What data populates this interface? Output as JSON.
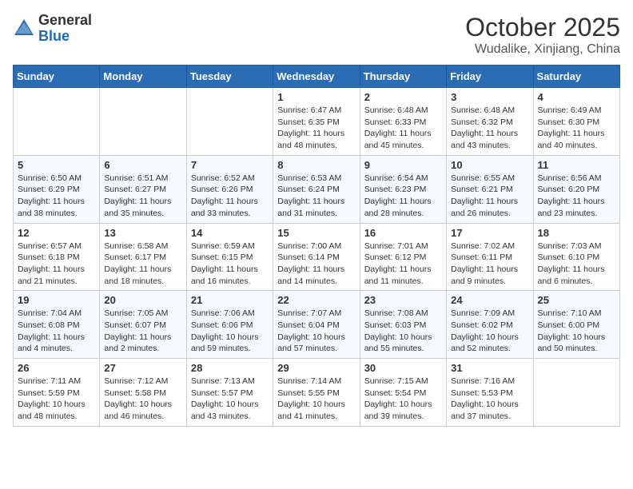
{
  "header": {
    "logo_general": "General",
    "logo_blue": "Blue",
    "month": "October 2025",
    "location": "Wudalike, Xinjiang, China"
  },
  "weekdays": [
    "Sunday",
    "Monday",
    "Tuesday",
    "Wednesday",
    "Thursday",
    "Friday",
    "Saturday"
  ],
  "weeks": [
    [
      {
        "day": "",
        "info": ""
      },
      {
        "day": "",
        "info": ""
      },
      {
        "day": "",
        "info": ""
      },
      {
        "day": "1",
        "info": "Sunrise: 6:47 AM\nSunset: 6:35 PM\nDaylight: 11 hours\nand 48 minutes."
      },
      {
        "day": "2",
        "info": "Sunrise: 6:48 AM\nSunset: 6:33 PM\nDaylight: 11 hours\nand 45 minutes."
      },
      {
        "day": "3",
        "info": "Sunrise: 6:48 AM\nSunset: 6:32 PM\nDaylight: 11 hours\nand 43 minutes."
      },
      {
        "day": "4",
        "info": "Sunrise: 6:49 AM\nSunset: 6:30 PM\nDaylight: 11 hours\nand 40 minutes."
      }
    ],
    [
      {
        "day": "5",
        "info": "Sunrise: 6:50 AM\nSunset: 6:29 PM\nDaylight: 11 hours\nand 38 minutes."
      },
      {
        "day": "6",
        "info": "Sunrise: 6:51 AM\nSunset: 6:27 PM\nDaylight: 11 hours\nand 35 minutes."
      },
      {
        "day": "7",
        "info": "Sunrise: 6:52 AM\nSunset: 6:26 PM\nDaylight: 11 hours\nand 33 minutes."
      },
      {
        "day": "8",
        "info": "Sunrise: 6:53 AM\nSunset: 6:24 PM\nDaylight: 11 hours\nand 31 minutes."
      },
      {
        "day": "9",
        "info": "Sunrise: 6:54 AM\nSunset: 6:23 PM\nDaylight: 11 hours\nand 28 minutes."
      },
      {
        "day": "10",
        "info": "Sunrise: 6:55 AM\nSunset: 6:21 PM\nDaylight: 11 hours\nand 26 minutes."
      },
      {
        "day": "11",
        "info": "Sunrise: 6:56 AM\nSunset: 6:20 PM\nDaylight: 11 hours\nand 23 minutes."
      }
    ],
    [
      {
        "day": "12",
        "info": "Sunrise: 6:57 AM\nSunset: 6:18 PM\nDaylight: 11 hours\nand 21 minutes."
      },
      {
        "day": "13",
        "info": "Sunrise: 6:58 AM\nSunset: 6:17 PM\nDaylight: 11 hours\nand 18 minutes."
      },
      {
        "day": "14",
        "info": "Sunrise: 6:59 AM\nSunset: 6:15 PM\nDaylight: 11 hours\nand 16 minutes."
      },
      {
        "day": "15",
        "info": "Sunrise: 7:00 AM\nSunset: 6:14 PM\nDaylight: 11 hours\nand 14 minutes."
      },
      {
        "day": "16",
        "info": "Sunrise: 7:01 AM\nSunset: 6:12 PM\nDaylight: 11 hours\nand 11 minutes."
      },
      {
        "day": "17",
        "info": "Sunrise: 7:02 AM\nSunset: 6:11 PM\nDaylight: 11 hours\nand 9 minutes."
      },
      {
        "day": "18",
        "info": "Sunrise: 7:03 AM\nSunset: 6:10 PM\nDaylight: 11 hours\nand 6 minutes."
      }
    ],
    [
      {
        "day": "19",
        "info": "Sunrise: 7:04 AM\nSunset: 6:08 PM\nDaylight: 11 hours\nand 4 minutes."
      },
      {
        "day": "20",
        "info": "Sunrise: 7:05 AM\nSunset: 6:07 PM\nDaylight: 11 hours\nand 2 minutes."
      },
      {
        "day": "21",
        "info": "Sunrise: 7:06 AM\nSunset: 6:06 PM\nDaylight: 10 hours\nand 59 minutes."
      },
      {
        "day": "22",
        "info": "Sunrise: 7:07 AM\nSunset: 6:04 PM\nDaylight: 10 hours\nand 57 minutes."
      },
      {
        "day": "23",
        "info": "Sunrise: 7:08 AM\nSunset: 6:03 PM\nDaylight: 10 hours\nand 55 minutes."
      },
      {
        "day": "24",
        "info": "Sunrise: 7:09 AM\nSunset: 6:02 PM\nDaylight: 10 hours\nand 52 minutes."
      },
      {
        "day": "25",
        "info": "Sunrise: 7:10 AM\nSunset: 6:00 PM\nDaylight: 10 hours\nand 50 minutes."
      }
    ],
    [
      {
        "day": "26",
        "info": "Sunrise: 7:11 AM\nSunset: 5:59 PM\nDaylight: 10 hours\nand 48 minutes."
      },
      {
        "day": "27",
        "info": "Sunrise: 7:12 AM\nSunset: 5:58 PM\nDaylight: 10 hours\nand 46 minutes."
      },
      {
        "day": "28",
        "info": "Sunrise: 7:13 AM\nSunset: 5:57 PM\nDaylight: 10 hours\nand 43 minutes."
      },
      {
        "day": "29",
        "info": "Sunrise: 7:14 AM\nSunset: 5:55 PM\nDaylight: 10 hours\nand 41 minutes."
      },
      {
        "day": "30",
        "info": "Sunrise: 7:15 AM\nSunset: 5:54 PM\nDaylight: 10 hours\nand 39 minutes."
      },
      {
        "day": "31",
        "info": "Sunrise: 7:16 AM\nSunset: 5:53 PM\nDaylight: 10 hours\nand 37 minutes."
      },
      {
        "day": "",
        "info": ""
      }
    ]
  ]
}
